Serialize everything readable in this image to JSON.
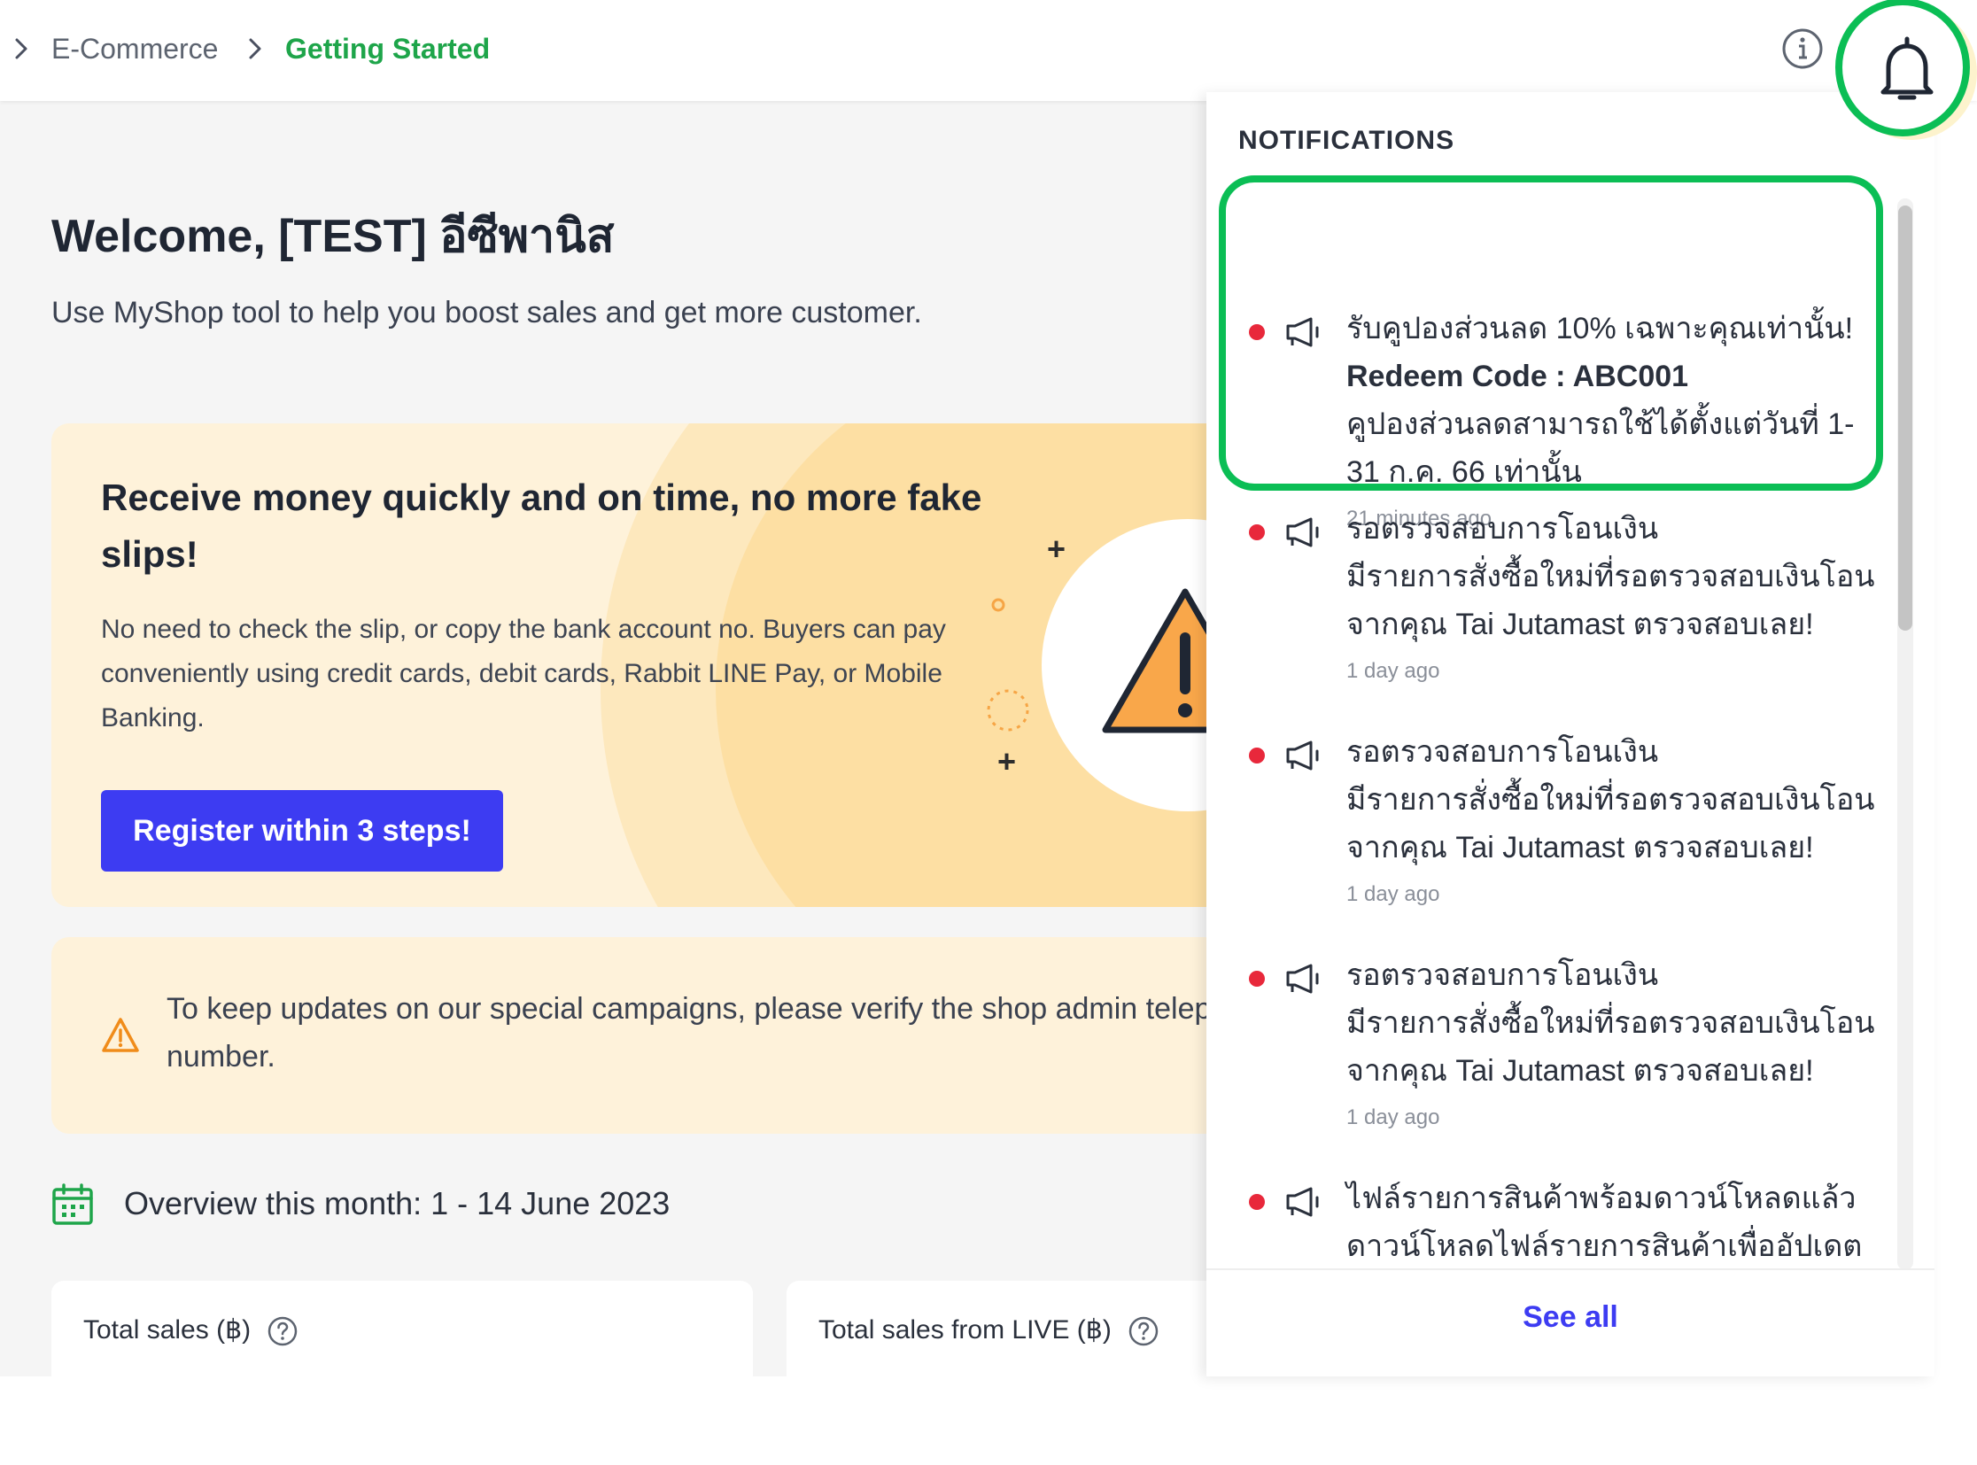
{
  "breadcrumb": {
    "items": [
      {
        "label": "E-Commerce",
        "current": false
      },
      {
        "label": "Getting Started",
        "current": true
      }
    ]
  },
  "colors": {
    "accent_green": "#1ea54a",
    "highlight_green": "#0bbe55",
    "primary_blue": "#3d3cf2",
    "unread_dot": "#e8283b",
    "banner_bg": "#fef2da"
  },
  "main": {
    "welcome": "Welcome, [TEST] อีซีพานิส",
    "subtitle": "Use MyShop tool to help you boost sales and get more customer.",
    "banner": {
      "title": "Receive money quickly and on time, no more fake slips!",
      "description": "No need to check the slip, or copy the bank account no. Buyers can pay conveniently using credit cards, debit cards, Rabbit LINE Pay, or Mobile Banking.",
      "button_label": "Register within 3 steps!"
    },
    "alert": {
      "text": "To keep updates on our special campaigns, please verify the shop admin telephone number."
    },
    "overview": {
      "text": "Overview this month: 1 - 14 June 2023"
    },
    "cards": [
      {
        "label": "Total sales (฿)"
      },
      {
        "label": "Total sales from LIVE (฿)"
      }
    ]
  },
  "notifications": {
    "title": "NOTIFICATIONS",
    "see_all": "See all",
    "items": [
      {
        "line1": "รับคูปองส่วนลด 10% เฉพาะคุณเท่านั้น!",
        "line2": "Redeem Code : ABC001",
        "body": "คูปองส่วนลดสามารถใช้ได้ตั้งแต่วันที่ 1-31 ก.ค. 66 เท่านั้น",
        "time": "21 minutes ago",
        "unread": true
      },
      {
        "line1": "รอตรวจสอบการโอนเงิน",
        "body": "มีรายการสั่งซื้อใหม่ที่รอตรวจสอบเงินโอนจากคุณ Tai Jutamast ตรวจสอบเลย!",
        "time": "1 day ago",
        "unread": true
      },
      {
        "line1": "รอตรวจสอบการโอนเงิน",
        "body": "มีรายการสั่งซื้อใหม่ที่รอตรวจสอบเงินโอนจากคุณ Tai Jutamast ตรวจสอบเลย!",
        "time": "1 day ago",
        "unread": true
      },
      {
        "line1": "รอตรวจสอบการโอนเงิน",
        "body": "มีรายการสั่งซื้อใหม่ที่รอตรวจสอบเงินโอนจากคุณ Tai Jutamast ตรวจสอบเลย!",
        "time": "1 day ago",
        "unread": true
      },
      {
        "line1": "ไฟล์รายการสินค้าพร้อมดาวน์โหลดแล้ว",
        "body": "ดาวน์โหลดไฟล์รายการสินค้าเพื่ออัปเดต",
        "time": "",
        "unread": true
      }
    ]
  },
  "icons": [
    "chevron-right-icon",
    "info-icon",
    "bell-icon",
    "warning-icon",
    "calendar-icon",
    "help-circle-icon",
    "megaphone-icon"
  ]
}
